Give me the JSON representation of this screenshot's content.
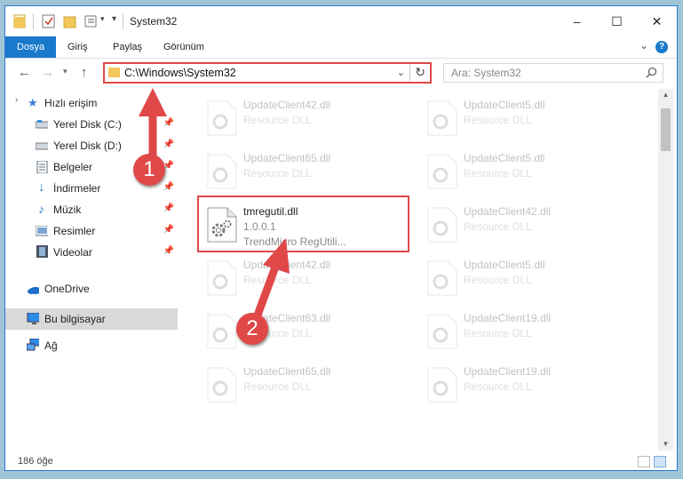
{
  "window": {
    "title": "System32",
    "controls": {
      "minimize": "–",
      "maximize": "☐",
      "close": "✕"
    }
  },
  "ribbon": {
    "tabs": [
      {
        "label": "Dosya"
      },
      {
        "label": "Giriş"
      },
      {
        "label": "Paylaş"
      },
      {
        "label": "Görünüm"
      }
    ],
    "help": "?"
  },
  "navigation": {
    "address": "C:\\Windows\\System32",
    "search_placeholder": "Ara: System32"
  },
  "sidebar": {
    "items": [
      {
        "label": "Hızlı erişim",
        "icon": "star-icon"
      },
      {
        "label": "Yerel Disk (C:)",
        "icon": "drive-icon"
      },
      {
        "label": "Yerel Disk (D:)",
        "icon": "drive-icon"
      },
      {
        "label": "Belgeler",
        "icon": "documents-icon"
      },
      {
        "label": "İndirmeler",
        "icon": "download-icon"
      },
      {
        "label": "Müzik",
        "icon": "music-icon"
      },
      {
        "label": "Resimler",
        "icon": "pictures-icon"
      },
      {
        "label": "Videolar",
        "icon": "videos-icon"
      },
      {
        "label": "OneDrive",
        "icon": "cloud-icon"
      },
      {
        "label": "Bu bilgisayar",
        "icon": "computer-icon"
      },
      {
        "label": "Ağ",
        "icon": "network-icon"
      }
    ]
  },
  "files": {
    "left": [
      {
        "name": "UpdateClient42.dll",
        "type": "Resource DLL"
      },
      {
        "name": "UpdateClient65.dll",
        "type": "Resource DLL"
      },
      {
        "name": "tmregutil.dll",
        "version": "1.0.0.1",
        "desc": "TrendMicro RegUtili..."
      },
      {
        "name": "UpdateClient42.dll",
        "type": "Resource DLL"
      },
      {
        "name": "UpdateClient63.dll",
        "type": "Resource DLL"
      },
      {
        "name": "UpdateClient65.dll",
        "type": "Resource DLL"
      }
    ],
    "right": [
      {
        "name": "UpdateClient5.dll",
        "type": "Resource DLL"
      },
      {
        "name": "UpdateClient5.dll",
        "type": "Resource DLL"
      },
      {
        "name": "UpdateClient42.dll",
        "type": "Resource DLL"
      },
      {
        "name": "UpdateClient5.dll",
        "type": "Resource DLL"
      },
      {
        "name": "UpdateClient19.dll",
        "type": "Resource DLL"
      },
      {
        "name": "UpdateClient19.dll",
        "type": "Resource DLL"
      }
    ]
  },
  "status": {
    "count": "186 öğe"
  },
  "annotations": {
    "badge1": "1",
    "badge2": "2",
    "color": "#e04848"
  }
}
